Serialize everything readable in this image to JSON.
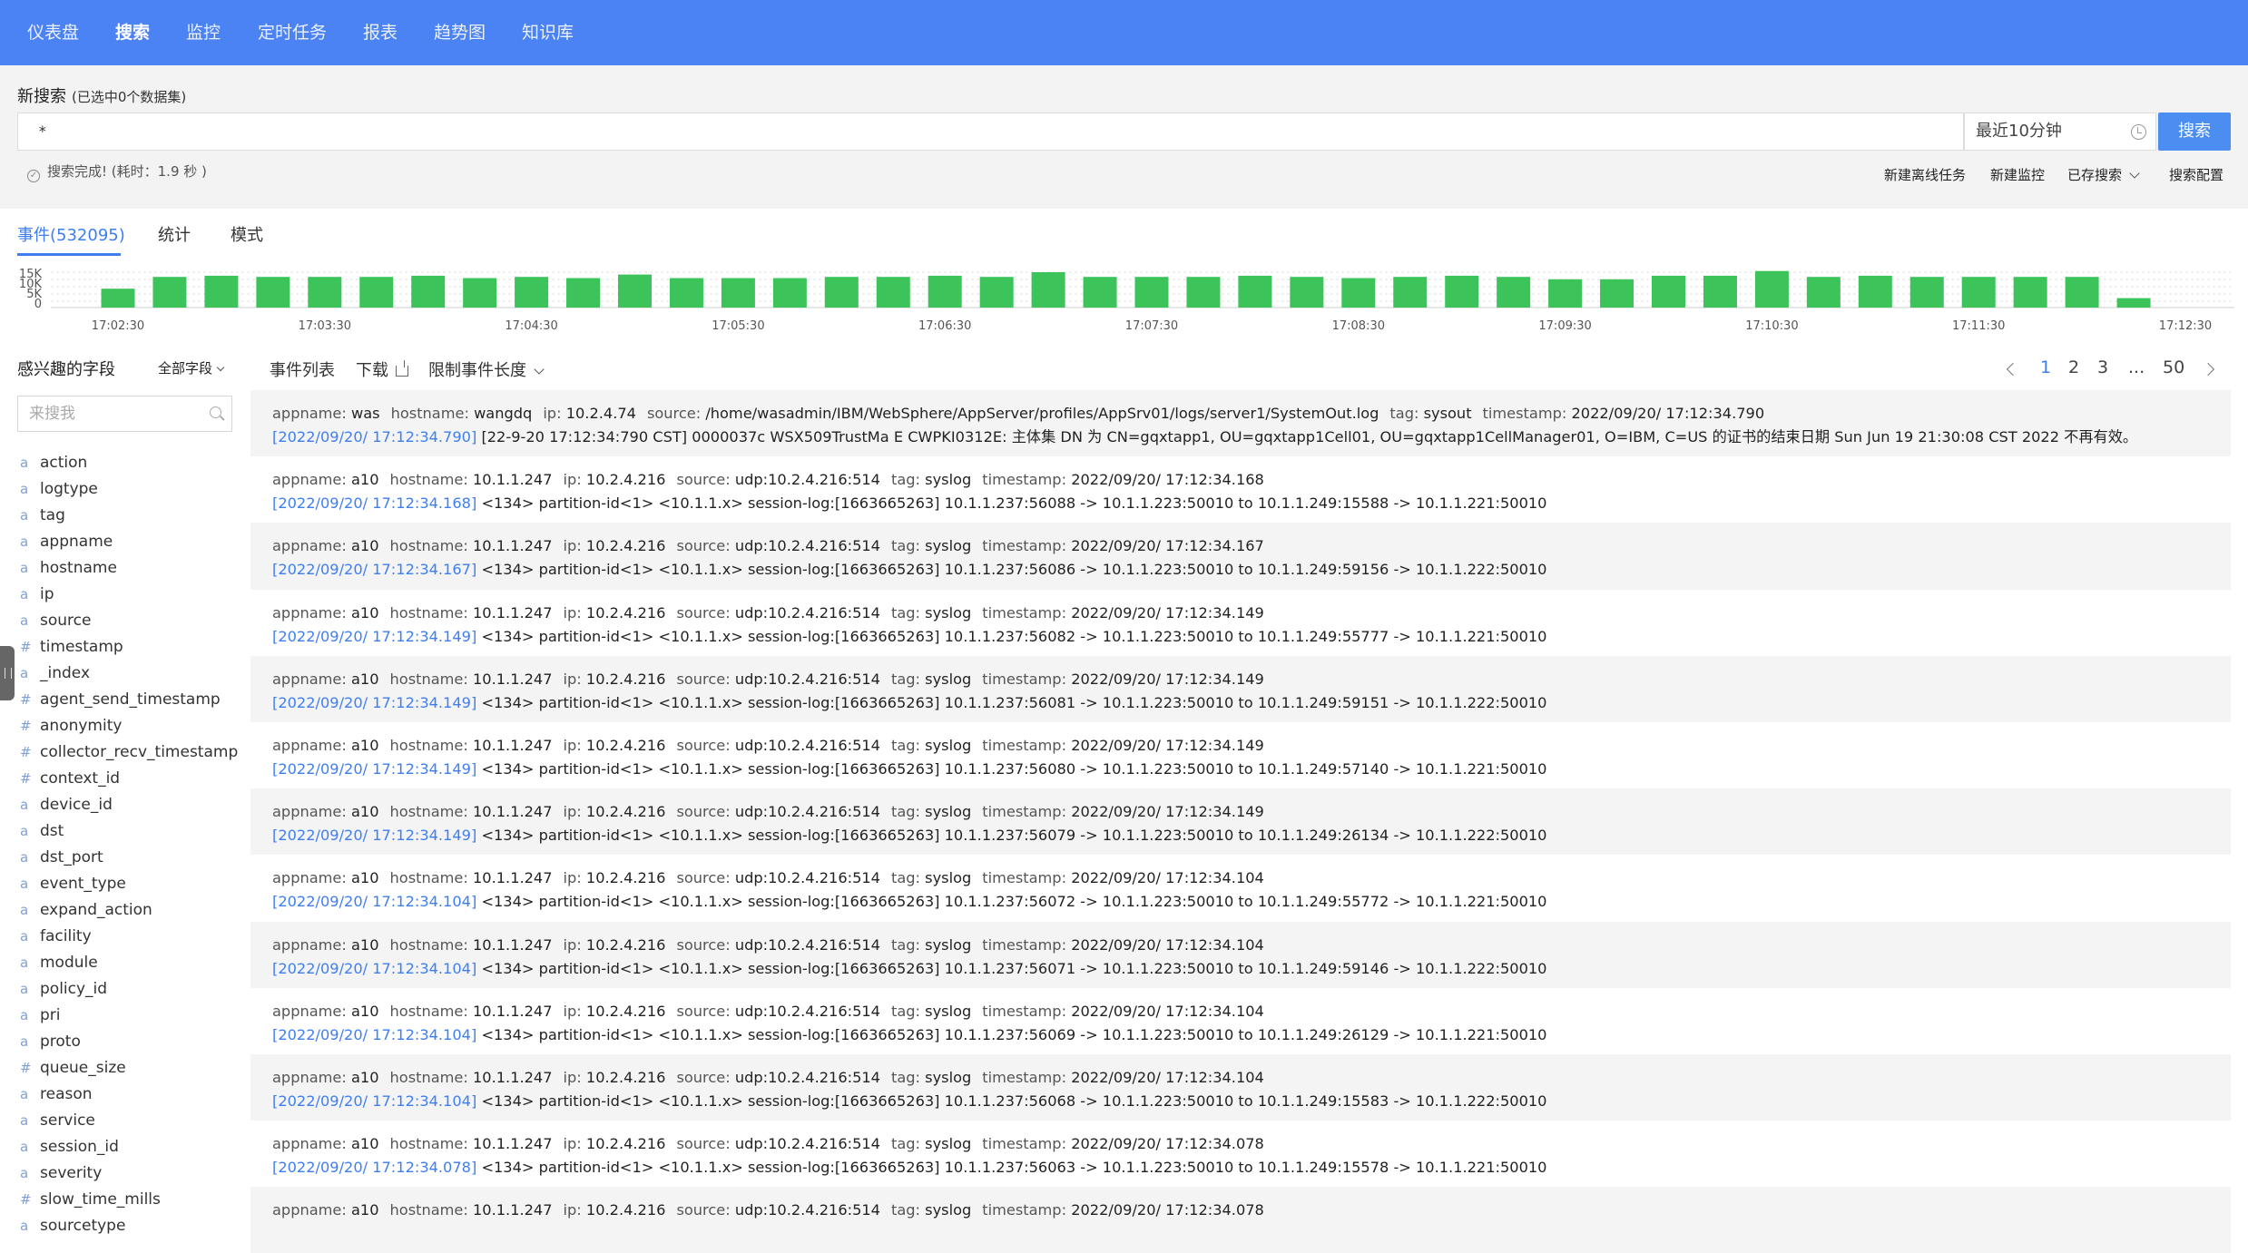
{
  "nav": {
    "items": [
      "仪表盘",
      "搜索",
      "监控",
      "定时任务",
      "报表",
      "趋势图",
      "知识库"
    ],
    "active_index": 1
  },
  "search": {
    "title": "新搜索",
    "subtitle": "(已选中0个数据集)",
    "query": "*",
    "time_range": "最近10分钟",
    "button": "搜索",
    "status": "搜索完成! (耗时：1.9 秒 )",
    "actions": {
      "offline_task": "新建离线任务",
      "new_monitor": "新建监控",
      "saved_search": "已存搜索",
      "search_config": "搜索配置"
    }
  },
  "tabs": [
    "事件(532095)",
    "统计",
    "模式"
  ],
  "chart_data": {
    "type": "bar",
    "y_ticks": [
      "15K",
      "10K",
      "5K",
      "0"
    ],
    "ylim": [
      0,
      15000
    ],
    "x_ticks": [
      "17:02:30",
      "17:03:30",
      "17:04:30",
      "17:05:30",
      "17:06:30",
      "17:07:30",
      "17:08:30",
      "17:09:30",
      "17:10:30",
      "17:11:30",
      "17:12:30"
    ],
    "values": [
      8000,
      13000,
      13500,
      13000,
      13000,
      13000,
      13500,
      12500,
      13000,
      12500,
      14000,
      12500,
      12500,
      12500,
      13000,
      13000,
      13500,
      13000,
      15000,
      13000,
      13000,
      13000,
      13500,
      13000,
      12500,
      13000,
      13500,
      13000,
      12000,
      12000,
      13500,
      13500,
      15500,
      13000,
      13500,
      13000,
      13000,
      13000,
      13000,
      4000
    ]
  },
  "fields": {
    "title": "感兴趣的字段",
    "all_label": "全部字段",
    "search_placeholder": "来搜我",
    "items": [
      {
        "type": "a",
        "name": "action"
      },
      {
        "type": "a",
        "name": "logtype"
      },
      {
        "type": "a",
        "name": "tag"
      },
      {
        "type": "a",
        "name": "appname"
      },
      {
        "type": "a",
        "name": "hostname"
      },
      {
        "type": "a",
        "name": "ip"
      },
      {
        "type": "a",
        "name": "source"
      },
      {
        "type": "#",
        "name": "timestamp"
      },
      {
        "type": "a",
        "name": "_index"
      },
      {
        "type": "#",
        "name": "agent_send_timestamp"
      },
      {
        "type": "#",
        "name": "anonymity"
      },
      {
        "type": "#",
        "name": "collector_recv_timestamp"
      },
      {
        "type": "#",
        "name": "context_id"
      },
      {
        "type": "a",
        "name": "device_id"
      },
      {
        "type": "a",
        "name": "dst"
      },
      {
        "type": "a",
        "name": "dst_port"
      },
      {
        "type": "a",
        "name": "event_type"
      },
      {
        "type": "a",
        "name": "expand_action"
      },
      {
        "type": "a",
        "name": "facility"
      },
      {
        "type": "a",
        "name": "module"
      },
      {
        "type": "a",
        "name": "policy_id"
      },
      {
        "type": "a",
        "name": "pri"
      },
      {
        "type": "a",
        "name": "proto"
      },
      {
        "type": "#",
        "name": "queue_size"
      },
      {
        "type": "a",
        "name": "reason"
      },
      {
        "type": "a",
        "name": "service"
      },
      {
        "type": "a",
        "name": "session_id"
      },
      {
        "type": "a",
        "name": "severity"
      },
      {
        "type": "#",
        "name": "slow_time_mills"
      },
      {
        "type": "a",
        "name": "sourcetype"
      }
    ]
  },
  "event_list": {
    "title": "事件列表",
    "download": "下载",
    "limit": "限制事件长度",
    "pages": [
      "1",
      "2",
      "3",
      "...",
      "50"
    ],
    "active_page": "1"
  },
  "events": [
    {
      "fields": [
        [
          "appname:",
          "was"
        ],
        [
          "hostname:",
          "wangdq"
        ],
        [
          "ip:",
          "10.2.4.74"
        ],
        [
          "source:",
          "/home/wasadmin/IBM/WebSphere/AppServer/profiles/AppSrv01/logs/server1/SystemOut.log"
        ],
        [
          "tag:",
          "sysout"
        ],
        [
          "timestamp:",
          "2022/09/20/ 17:12:34.790"
        ]
      ],
      "ts": "[2022/09/20/ 17:12:34.790]",
      "raw": "[22-9-20 17:12:34:790 CST] 0000037c WSX509TrustMa E CWPKI0312E: 主体集 DN 为 CN=gqxtapp1, OU=gqxtapp1Cell01, OU=gqxtapp1CellManager01, O=IBM, C=US 的证书的结束日期 Sun Jun 19 21:30:08 CST 2022 不再有效。"
    },
    {
      "fields": [
        [
          "appname:",
          "a10"
        ],
        [
          "hostname:",
          "10.1.1.247"
        ],
        [
          "ip:",
          "10.2.4.216"
        ],
        [
          "source:",
          "udp:10.2.4.216:514"
        ],
        [
          "tag:",
          "syslog"
        ],
        [
          "timestamp:",
          "2022/09/20/ 17:12:34.168"
        ]
      ],
      "ts": "[2022/09/20/ 17:12:34.168]",
      "raw": "<134> partition-id<1> <10.1.1.x> session-log:[1663665263] 10.1.1.237:56088 -> 10.1.1.223:50010 to 10.1.1.249:15588 -> 10.1.1.221:50010"
    },
    {
      "fields": [
        [
          "appname:",
          "a10"
        ],
        [
          "hostname:",
          "10.1.1.247"
        ],
        [
          "ip:",
          "10.2.4.216"
        ],
        [
          "source:",
          "udp:10.2.4.216:514"
        ],
        [
          "tag:",
          "syslog"
        ],
        [
          "timestamp:",
          "2022/09/20/ 17:12:34.167"
        ]
      ],
      "ts": "[2022/09/20/ 17:12:34.167]",
      "raw": "<134> partition-id<1> <10.1.1.x> session-log:[1663665263] 10.1.1.237:56086 -> 10.1.1.223:50010 to 10.1.1.249:59156 -> 10.1.1.222:50010"
    },
    {
      "fields": [
        [
          "appname:",
          "a10"
        ],
        [
          "hostname:",
          "10.1.1.247"
        ],
        [
          "ip:",
          "10.2.4.216"
        ],
        [
          "source:",
          "udp:10.2.4.216:514"
        ],
        [
          "tag:",
          "syslog"
        ],
        [
          "timestamp:",
          "2022/09/20/ 17:12:34.149"
        ]
      ],
      "ts": "[2022/09/20/ 17:12:34.149]",
      "raw": "<134> partition-id<1> <10.1.1.x> session-log:[1663665263] 10.1.1.237:56082 -> 10.1.1.223:50010 to 10.1.1.249:55777 -> 10.1.1.221:50010"
    },
    {
      "fields": [
        [
          "appname:",
          "a10"
        ],
        [
          "hostname:",
          "10.1.1.247"
        ],
        [
          "ip:",
          "10.2.4.216"
        ],
        [
          "source:",
          "udp:10.2.4.216:514"
        ],
        [
          "tag:",
          "syslog"
        ],
        [
          "timestamp:",
          "2022/09/20/ 17:12:34.149"
        ]
      ],
      "ts": "[2022/09/20/ 17:12:34.149]",
      "raw": "<134> partition-id<1> <10.1.1.x> session-log:[1663665263] 10.1.1.237:56081 -> 10.1.1.223:50010 to 10.1.1.249:59151 -> 10.1.1.222:50010"
    },
    {
      "fields": [
        [
          "appname:",
          "a10"
        ],
        [
          "hostname:",
          "10.1.1.247"
        ],
        [
          "ip:",
          "10.2.4.216"
        ],
        [
          "source:",
          "udp:10.2.4.216:514"
        ],
        [
          "tag:",
          "syslog"
        ],
        [
          "timestamp:",
          "2022/09/20/ 17:12:34.149"
        ]
      ],
      "ts": "[2022/09/20/ 17:12:34.149]",
      "raw": "<134> partition-id<1> <10.1.1.x> session-log:[1663665263] 10.1.1.237:56080 -> 10.1.1.223:50010 to 10.1.1.249:57140 -> 10.1.1.221:50010"
    },
    {
      "fields": [
        [
          "appname:",
          "a10"
        ],
        [
          "hostname:",
          "10.1.1.247"
        ],
        [
          "ip:",
          "10.2.4.216"
        ],
        [
          "source:",
          "udp:10.2.4.216:514"
        ],
        [
          "tag:",
          "syslog"
        ],
        [
          "timestamp:",
          "2022/09/20/ 17:12:34.149"
        ]
      ],
      "ts": "[2022/09/20/ 17:12:34.149]",
      "raw": "<134> partition-id<1> <10.1.1.x> session-log:[1663665263] 10.1.1.237:56079 -> 10.1.1.223:50010 to 10.1.1.249:26134 -> 10.1.1.222:50010"
    },
    {
      "fields": [
        [
          "appname:",
          "a10"
        ],
        [
          "hostname:",
          "10.1.1.247"
        ],
        [
          "ip:",
          "10.2.4.216"
        ],
        [
          "source:",
          "udp:10.2.4.216:514"
        ],
        [
          "tag:",
          "syslog"
        ],
        [
          "timestamp:",
          "2022/09/20/ 17:12:34.104"
        ]
      ],
      "ts": "[2022/09/20/ 17:12:34.104]",
      "raw": "<134> partition-id<1> <10.1.1.x> session-log:[1663665263] 10.1.1.237:56072 -> 10.1.1.223:50010 to 10.1.1.249:55772 -> 10.1.1.221:50010"
    },
    {
      "fields": [
        [
          "appname:",
          "a10"
        ],
        [
          "hostname:",
          "10.1.1.247"
        ],
        [
          "ip:",
          "10.2.4.216"
        ],
        [
          "source:",
          "udp:10.2.4.216:514"
        ],
        [
          "tag:",
          "syslog"
        ],
        [
          "timestamp:",
          "2022/09/20/ 17:12:34.104"
        ]
      ],
      "ts": "[2022/09/20/ 17:12:34.104]",
      "raw": "<134> partition-id<1> <10.1.1.x> session-log:[1663665263] 10.1.1.237:56071 -> 10.1.1.223:50010 to 10.1.1.249:59146 -> 10.1.1.222:50010"
    },
    {
      "fields": [
        [
          "appname:",
          "a10"
        ],
        [
          "hostname:",
          "10.1.1.247"
        ],
        [
          "ip:",
          "10.2.4.216"
        ],
        [
          "source:",
          "udp:10.2.4.216:514"
        ],
        [
          "tag:",
          "syslog"
        ],
        [
          "timestamp:",
          "2022/09/20/ 17:12:34.104"
        ]
      ],
      "ts": "[2022/09/20/ 17:12:34.104]",
      "raw": "<134> partition-id<1> <10.1.1.x> session-log:[1663665263] 10.1.1.237:56069 -> 10.1.1.223:50010 to 10.1.1.249:26129 -> 10.1.1.221:50010"
    },
    {
      "fields": [
        [
          "appname:",
          "a10"
        ],
        [
          "hostname:",
          "10.1.1.247"
        ],
        [
          "ip:",
          "10.2.4.216"
        ],
        [
          "source:",
          "udp:10.2.4.216:514"
        ],
        [
          "tag:",
          "syslog"
        ],
        [
          "timestamp:",
          "2022/09/20/ 17:12:34.104"
        ]
      ],
      "ts": "[2022/09/20/ 17:12:34.104]",
      "raw": "<134> partition-id<1> <10.1.1.x> session-log:[1663665263] 10.1.1.237:56068 -> 10.1.1.223:50010 to 10.1.1.249:15583 -> 10.1.1.222:50010"
    },
    {
      "fields": [
        [
          "appname:",
          "a10"
        ],
        [
          "hostname:",
          "10.1.1.247"
        ],
        [
          "ip:",
          "10.2.4.216"
        ],
        [
          "source:",
          "udp:10.2.4.216:514"
        ],
        [
          "tag:",
          "syslog"
        ],
        [
          "timestamp:",
          "2022/09/20/ 17:12:34.078"
        ]
      ],
      "ts": "[2022/09/20/ 17:12:34.078]",
      "raw": "<134> partition-id<1> <10.1.1.x> session-log:[1663665263] 10.1.1.237:56063 -> 10.1.1.223:50010 to 10.1.1.249:15578 -> 10.1.1.221:50010"
    },
    {
      "fields": [
        [
          "appname:",
          "a10"
        ],
        [
          "hostname:",
          "10.1.1.247"
        ],
        [
          "ip:",
          "10.2.4.216"
        ],
        [
          "source:",
          "udp:10.2.4.216:514"
        ],
        [
          "tag:",
          "syslog"
        ],
        [
          "timestamp:",
          "2022/09/20/ 17:12:34.078"
        ]
      ],
      "ts": "",
      "raw": ""
    }
  ]
}
